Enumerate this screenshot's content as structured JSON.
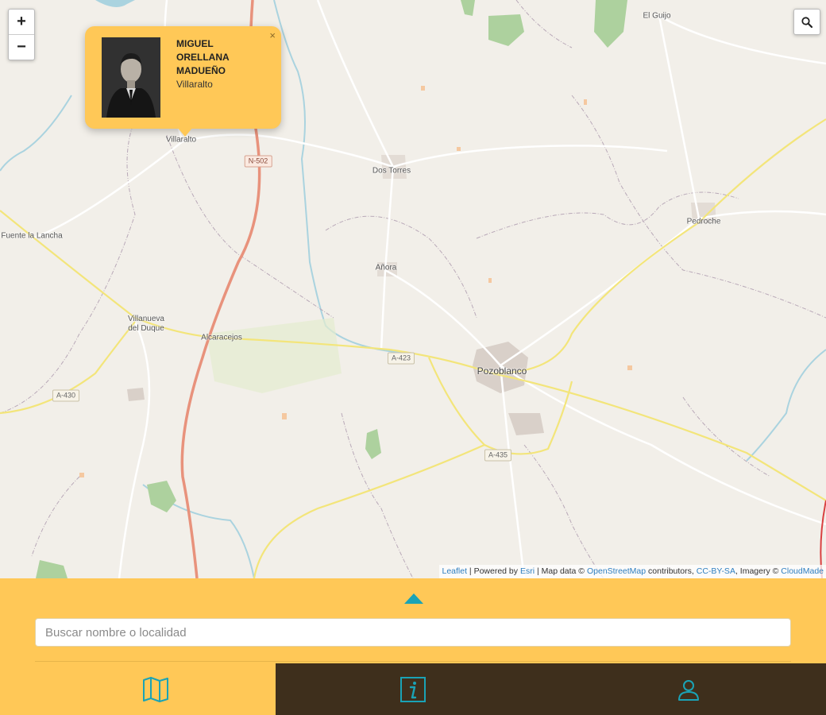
{
  "map": {
    "places": [
      {
        "name": "El Guijo"
      },
      {
        "name": "Villaralto"
      },
      {
        "name": "Dos Torres"
      },
      {
        "name": "Pedroche"
      },
      {
        "name": "Fuente la Lancha"
      },
      {
        "name": "Añora"
      },
      {
        "name": "Villanueva\ndel Duque"
      },
      {
        "name": "Alcaracejos"
      },
      {
        "name": "Pozoblanco"
      }
    ],
    "road_labels": [
      "N-502",
      "A-423",
      "A-430",
      "A-435"
    ],
    "zoom_in_label": "+",
    "zoom_out_label": "−",
    "search_icon": "magnifier-icon"
  },
  "popup": {
    "name": "MIGUEL ORELLANA MADUEÑO",
    "location": "Villaralto",
    "close_label": "×"
  },
  "attribution": {
    "leaflet": "Leaflet",
    "sep1": " | Powered by ",
    "esri": "Esri",
    "sep2": " | Map data © ",
    "osm": "OpenStreetMap",
    "sep3": " contributors, ",
    "license": "CC-BY-SA",
    "sep4": ", Imagery © ",
    "cloudmade": "CloudMade"
  },
  "panel": {
    "search_placeholder": "Buscar nombre o localidad",
    "tabs": [
      {
        "icon": "map-icon"
      },
      {
        "icon": "info-icon"
      },
      {
        "icon": "user-icon"
      }
    ]
  },
  "colors": {
    "accent": "#ffc857",
    "teal": "#1aa3b6",
    "dark": "#3e2f1c"
  }
}
